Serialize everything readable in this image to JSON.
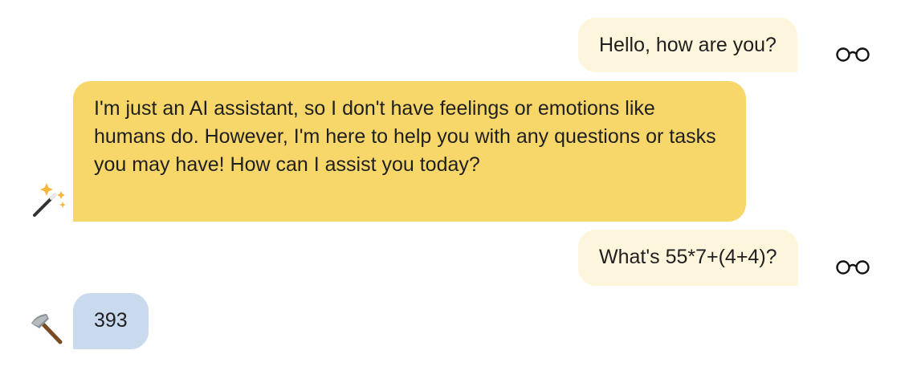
{
  "messages": [
    {
      "role": "user",
      "text": "Hello, how are you?",
      "icon": "glasses-icon"
    },
    {
      "role": "assistant",
      "text": "I'm just an AI assistant, so I don't have feelings or emotions like humans do. However, I'm here to help you with any questions or tasks you may have! How can I assist you today?",
      "icon": "magic-wand-icon"
    },
    {
      "role": "user",
      "text": "What's 55*7+(4+4)?",
      "icon": "glasses-icon"
    },
    {
      "role": "tool",
      "text": "393",
      "icon": "hammer-icon"
    }
  ],
  "colors": {
    "user_bubble": "#fdf6dd",
    "assistant_bubble": "#f8d76a",
    "tool_bubble": "#c9d9ee"
  }
}
